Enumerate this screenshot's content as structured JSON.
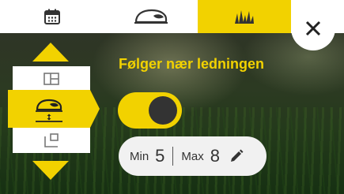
{
  "tabs": [
    {
      "icon": "calendar-icon",
      "active": false
    },
    {
      "icon": "robot-mower-icon",
      "active": false
    },
    {
      "icon": "grass-icon",
      "active": true
    }
  ],
  "colors": {
    "accent": "#f2d200",
    "knob": "#333333",
    "pill": "#f1f1f1"
  },
  "menu": {
    "items": [
      {
        "icon": "area-layout-icon",
        "active": false
      },
      {
        "icon": "mower-height-icon",
        "active": true
      },
      {
        "icon": "boundary-corner-icon",
        "active": false
      }
    ]
  },
  "settings": {
    "title": "Følger nær ledningen",
    "toggle_on": true,
    "min_label": "Min",
    "min_value": "5",
    "max_label": "Max",
    "max_value": "8"
  }
}
